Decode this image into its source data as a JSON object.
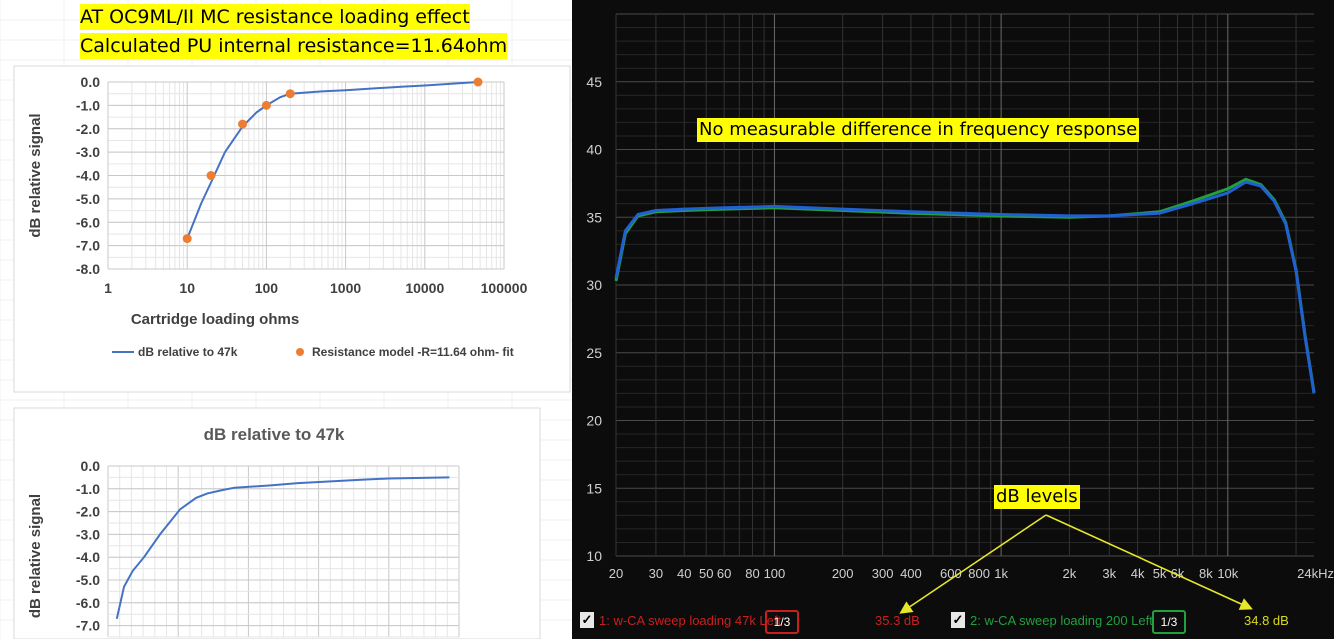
{
  "header": {
    "title_line1": "AT OC9ML/II MC resistance loading effect",
    "title_line2": "Calculated PU internal resistance=11.64ohm"
  },
  "chart_data": [
    {
      "type": "line",
      "ylabel": "dB relative signal",
      "xlabel": "Cartridge loading ohms",
      "x_scale": "log",
      "xlim": [
        1,
        100000
      ],
      "ylim": [
        -8,
        0
      ],
      "x_ticks": [
        "1",
        "10",
        "100",
        "1000",
        "10000",
        "100000"
      ],
      "y_ticks": [
        "0.0",
        "-1.0",
        "-2.0",
        "-3.0",
        "-4.0",
        "-5.0",
        "-6.0",
        "-7.0",
        "-8.0"
      ],
      "grid": true,
      "legend_position": "bottom",
      "series": [
        {
          "name": "dB relative to 47k",
          "kind": "line",
          "color": "#4472c4",
          "x": [
            10,
            15,
            20,
            30,
            50,
            75,
            100,
            150,
            200,
            500,
            1000,
            5000,
            10000,
            47000
          ],
          "y": [
            -6.7,
            -5.2,
            -4.3,
            -3.0,
            -1.9,
            -1.3,
            -1.0,
            -0.65,
            -0.5,
            -0.4,
            -0.35,
            -0.2,
            -0.15,
            0.0
          ]
        },
        {
          "name": "Resistance model -R=11.64 ohm- fit",
          "kind": "scatter",
          "color": "#ed7d31",
          "x": [
            10,
            20,
            50,
            100,
            200,
            47000
          ],
          "y": [
            -6.7,
            -4.0,
            -1.8,
            -1.0,
            -0.5,
            0.0
          ]
        }
      ]
    },
    {
      "type": "line",
      "title": "dB relative to 47k",
      "ylabel": "dB relative signal",
      "y_ticks": [
        "0.0",
        "-1.0",
        "-2.0",
        "-3.0",
        "-4.0",
        "-5.0",
        "-6.0",
        "-7.0"
      ],
      "ylim": [
        -7.5,
        0
      ],
      "grid": true,
      "series": [
        {
          "color": "#4472c4",
          "x": [
            10,
            12,
            15,
            20,
            30,
            50,
            75,
            100,
            150,
            200,
            500,
            1000,
            5000,
            10000,
            47000
          ],
          "y": [
            -6.7,
            -5.3,
            -4.6,
            -4.0,
            -3.0,
            -1.9,
            -1.4,
            -1.2,
            -1.05,
            -0.95,
            -0.85,
            -0.75,
            -0.6,
            -0.55,
            -0.5
          ]
        }
      ]
    },
    {
      "type": "line",
      "x_scale": "log",
      "xlim": [
        20,
        24000
      ],
      "ylim": [
        10,
        50
      ],
      "x_ticks": [
        "20",
        "30",
        "40",
        "50",
        "60",
        "80",
        "100",
        "200",
        "300",
        "400",
        "600",
        "800",
        "1k",
        "2k",
        "3k",
        "4k",
        "5k",
        "6k",
        "8k",
        "10k",
        "24kHz"
      ],
      "y_ticks": [
        "45",
        "40",
        "35",
        "30",
        "25",
        "20",
        "15",
        "10"
      ],
      "grid": true,
      "annotations": [
        "No measurable difference in frequency response",
        "dB levels"
      ],
      "series": [
        {
          "name": "1: w-CA sweep loading 47k Left",
          "color": "#2060d0",
          "x": [
            20,
            22,
            25,
            30,
            40,
            60,
            100,
            200,
            400,
            1000,
            2000,
            3000,
            5000,
            7000,
            10000,
            12000,
            14000,
            16000,
            18000,
            20000,
            22000,
            24000
          ],
          "y": [
            30.5,
            34.0,
            35.2,
            35.5,
            35.6,
            35.7,
            35.8,
            35.6,
            35.4,
            35.2,
            35.1,
            35.1,
            35.3,
            36.0,
            36.8,
            37.6,
            37.3,
            36.2,
            34.5,
            31.0,
            26.0,
            22.0
          ]
        },
        {
          "name": "2: w-CA sweep loading 200 Left",
          "color": "#22a040",
          "x": [
            20,
            22,
            25,
            30,
            40,
            60,
            100,
            200,
            400,
            1000,
            2000,
            3000,
            5000,
            7000,
            10000,
            12000,
            14000,
            16000,
            18000,
            20000,
            22000,
            24000
          ],
          "y": [
            30.3,
            33.8,
            35.1,
            35.4,
            35.5,
            35.6,
            35.7,
            35.5,
            35.3,
            35.1,
            35.0,
            35.1,
            35.4,
            36.2,
            37.1,
            37.8,
            37.4,
            36.3,
            34.6,
            31.1,
            26.1,
            22.1
          ]
        }
      ],
      "legend": {
        "item1": {
          "label": "1: w-CA sweep loading 47k Left",
          "smoothing": "1/3",
          "level": "35.3 dB"
        },
        "item2": {
          "label": "2: w-CA sweep loading 200 Left",
          "smoothing": "1/3",
          "level": "34.8 dB"
        }
      }
    }
  ],
  "checkbox_mark": "✓"
}
